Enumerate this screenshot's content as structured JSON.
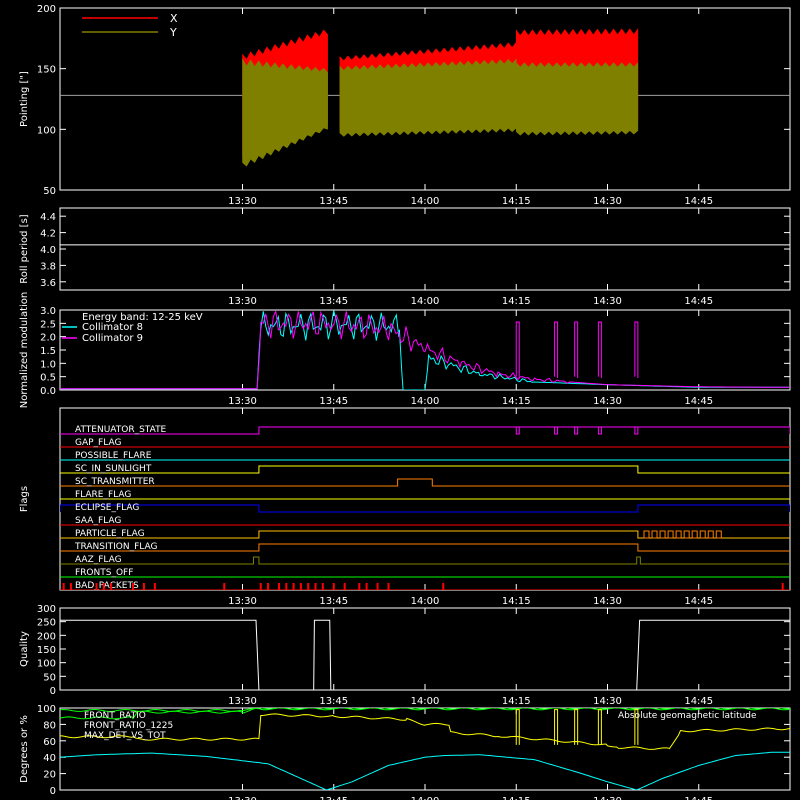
{
  "time_ticks": [
    "13:30",
    "13:45",
    "14:00",
    "14:15",
    "14:30",
    "14:45"
  ],
  "colors": {
    "background": "#000000",
    "axes": "#ffffff",
    "red": "#ff0000",
    "olive": "#808000",
    "cyan": "#00ffff",
    "magenta": "#ff00ff",
    "yellow": "#ffff00",
    "green": "#00ff00",
    "orange": "#ff8000",
    "blue": "#0000ff",
    "gold": "#ffc000",
    "purple": "#c040ff",
    "gray": "#a0a0a0"
  },
  "chart_data": [
    {
      "type": "line",
      "ylabel": "Pointing [\"]",
      "ylim": [
        50,
        200
      ],
      "yticks": [
        "50",
        "100",
        "150",
        "200"
      ],
      "legend": {
        "placement": "top-left"
      },
      "reference_line": 128,
      "series": [
        {
          "name": "X",
          "color": "#ff0000",
          "segments": [
            {
              "x": [
                13.5,
                13.7333
              ],
              "low": [
                72,
                105
              ],
              "high": [
                162,
                183
              ]
            },
            {
              "x": [
                13.7667,
                14.25
              ],
              "low": [
                98,
                100
              ],
              "high": [
                160,
                172
              ]
            },
            {
              "x": [
                14.25,
                14.5833
              ],
              "low": [
                102,
                103
              ],
              "high": [
                182,
                183
              ]
            }
          ]
        },
        {
          "name": "Y",
          "color": "#808000",
          "segments": [
            {
              "x": [
                13.5,
                13.7333
              ],
              "low": [
                68,
                100
              ],
              "high": [
                158,
                150
              ]
            },
            {
              "x": [
                13.7667,
                14.25
              ],
              "low": [
                94,
                98
              ],
              "high": [
                152,
                158
              ]
            },
            {
              "x": [
                14.25,
                14.5833
              ],
              "low": [
                95,
                96
              ],
              "high": [
                155,
                155
              ]
            }
          ]
        }
      ]
    },
    {
      "type": "line",
      "ylabel": "Roll period [s]",
      "ylim": [
        3.5,
        4.5
      ],
      "yticks": [
        "3.6",
        "3.8",
        "4.0",
        "4.2",
        "4.4"
      ],
      "series": [
        {
          "color": "#ffffff",
          "x": [
            13.0,
            15.0
          ],
          "values": [
            4.05,
            4.05
          ]
        }
      ]
    },
    {
      "type": "line",
      "ylabel": "Normalized modulation",
      "ylim": [
        0,
        3
      ],
      "yticks": [
        "0.0",
        "0.5",
        "1.0",
        "1.5",
        "2.0",
        "2.5",
        "3.0"
      ],
      "legend": {
        "placement": "top-left",
        "title": "Energy band: 12-25 keV"
      },
      "series": [
        {
          "name": "Collimator 8",
          "color": "#00ffff",
          "x": [
            13.0,
            13.54,
            13.55,
            13.75,
            13.93,
            13.94,
            14.0,
            14.01,
            14.15,
            14.3,
            14.5,
            14.75,
            15.0
          ],
          "values": [
            0.05,
            0.05,
            2.4,
            2.45,
            2.4,
            0.0,
            0.0,
            1.2,
            0.6,
            0.3,
            0.2,
            0.1,
            0.1
          ]
        },
        {
          "name": "Collimator 9",
          "color": "#ff00ff",
          "x": [
            13.0,
            13.54,
            13.55,
            13.75,
            13.9,
            14.0,
            14.1,
            14.2,
            14.3,
            14.5,
            14.75,
            15.0
          ],
          "values": [
            0.05,
            0.05,
            2.5,
            2.5,
            2.3,
            1.55,
            1.0,
            0.6,
            0.4,
            0.2,
            0.12,
            0.1
          ]
        }
      ]
    },
    {
      "type": "line",
      "ylabel": "Flags",
      "flags": [
        {
          "name": "ATTENUATOR_STATE",
          "color": "#ff00ff",
          "on": [
            [
              13.545,
              15.0
            ]
          ]
        },
        {
          "name": "GAP_FLAG",
          "color": "#ff0000",
          "on": []
        },
        {
          "name": "POSSIBLE_FLARE",
          "color": "#00ffff",
          "on": []
        },
        {
          "name": "SC_IN_SUNLIGHT",
          "color": "#ffff00",
          "on": [
            [
              13.545,
              14.5833
            ]
          ]
        },
        {
          "name": "SC_TRANSMITTER",
          "color": "#ff8000",
          "on": [
            [
              13.925,
              14.02
            ]
          ]
        },
        {
          "name": "FLARE_FLAG",
          "color": "#ffff00",
          "on": []
        },
        {
          "name": "ECLIPSE_FLAG",
          "color": "#0000ff",
          "on": [
            [
              13.0,
              13.545
            ],
            [
              14.5833,
              15.0
            ]
          ]
        },
        {
          "name": "SAA_FLAG",
          "color": "#ff0000",
          "on": []
        },
        {
          "name": "PARTICLE_FLAG",
          "color": "#ffc000",
          "on": [
            [
              13.545,
              14.5833
            ]
          ]
        },
        {
          "name": "TRANSITION_FLAG",
          "color": "#ff8000",
          "on": [
            [
              13.545,
              14.5833
            ]
          ]
        },
        {
          "name": "AAZ_FLAG",
          "color": "#808000",
          "on": [
            [
              13.53,
              13.545
            ],
            [
              14.58,
              14.59
            ]
          ]
        },
        {
          "name": "FRONTS_OFF",
          "color": "#00ff00",
          "on": []
        },
        {
          "name": "BAD_PACKETS",
          "color": "#ff0000",
          "on": []
        }
      ]
    },
    {
      "type": "line",
      "ylabel": "Quality",
      "ylim": [
        0,
        300
      ],
      "yticks": [
        "0",
        "50",
        "100",
        "150",
        "200",
        "250",
        "300"
      ],
      "series": [
        {
          "color": "#ffffff",
          "x": [
            13.0,
            13.537,
            13.545,
            13.695,
            13.697,
            13.739,
            13.742,
            14.58,
            14.588,
            15.0
          ],
          "values": [
            255,
            255,
            0,
            0,
            255,
            255,
            0,
            0,
            255,
            255
          ]
        }
      ]
    },
    {
      "type": "line",
      "ylabel": "Degrees or %",
      "ylim": [
        0,
        100
      ],
      "yticks": [
        "0",
        "20",
        "40",
        "60",
        "80",
        "100"
      ],
      "annotations": [
        "Absolute geomagnetic latitude"
      ],
      "series": [
        {
          "name": "FRONT_RATIO",
          "color": "#00ff00",
          "x": [
            13.0,
            13.2,
            13.21,
            13.5,
            13.55,
            15.0
          ],
          "values": [
            88,
            88,
            95,
            95,
            100,
            100
          ]
        },
        {
          "name": "FRONT_RATIO_1225",
          "color": "#00ff00",
          "x": [
            13.0,
            13.5,
            13.55,
            15.0
          ],
          "values": [
            97,
            97,
            99,
            99
          ]
        },
        {
          "name": "MAX_DET_VS_TOT",
          "color": "#ffff00",
          "x": [
            13.0,
            13.2,
            13.21,
            13.545,
            13.55,
            13.75,
            13.95,
            14.0,
            14.07,
            14.07,
            14.2,
            14.5,
            14.53,
            14.67,
            14.7,
            15.0
          ],
          "values": [
            65,
            65,
            62,
            62,
            92,
            90,
            86,
            80,
            80,
            70,
            66,
            55,
            52,
            50,
            72,
            75
          ]
        },
        {
          "name": "",
          "color": "#00ffff",
          "x": [
            13.0,
            13.1,
            13.25,
            13.4,
            13.57,
            13.73,
            13.8,
            13.9,
            14.0,
            14.05,
            14.15,
            14.3,
            14.43,
            14.5,
            14.58,
            14.65,
            14.75,
            14.85,
            14.95,
            15.0
          ],
          "values": [
            40,
            43,
            45,
            41,
            32,
            0,
            10,
            30,
            40,
            42,
            43,
            37,
            20,
            10,
            0,
            14,
            30,
            42,
            46,
            46
          ]
        }
      ]
    }
  ]
}
